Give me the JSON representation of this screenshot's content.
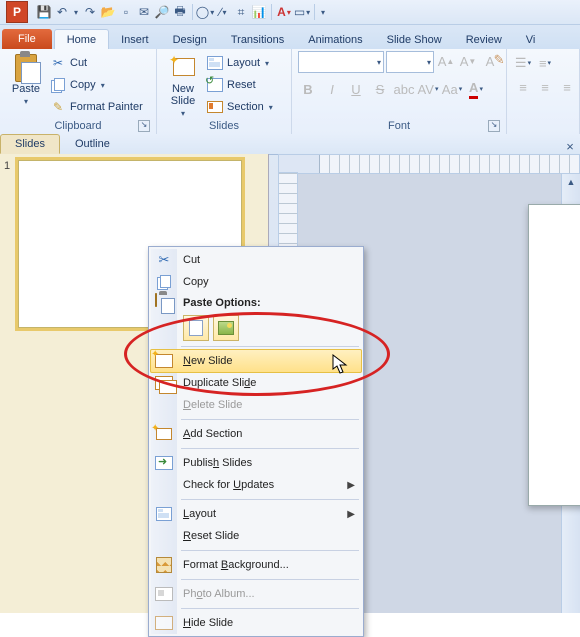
{
  "tabs": {
    "file": "File",
    "home": "Home",
    "insert": "Insert",
    "design": "Design",
    "transitions": "Transitions",
    "animations": "Animations",
    "slideshow": "Slide Show",
    "review": "Review",
    "view": "Vi"
  },
  "ribbon": {
    "clipboard": {
      "label": "Clipboard",
      "paste": "Paste",
      "cut": "Cut",
      "copy": "Copy",
      "painter": "Format Painter"
    },
    "slides": {
      "label": "Slides",
      "newslide": "New\nSlide",
      "layout": "Layout",
      "reset": "Reset",
      "section": "Section"
    },
    "font": {
      "label": "Font"
    }
  },
  "panes": {
    "slides": "Slides",
    "outline": "Outline",
    "slide_number": "1"
  },
  "ctx": {
    "cut": "Cut",
    "copy": "Copy",
    "paste_options": "Paste Options:",
    "new_slide_pre": "N",
    "new_slide_post": "ew Slide",
    "duplicate_pre": "Duplicate Sli",
    "duplicate_u": "d",
    "duplicate_post": "e",
    "delete_pre": "D",
    "delete_post": "elete Slide",
    "add_section_pre": "A",
    "add_section_post": "dd Section",
    "publish_pre": "Publis",
    "publish_u": "h",
    "publish_post": " Slides",
    "updates_pre": "Check for ",
    "updates_u": "U",
    "updates_post": "pdates",
    "layout_pre": "L",
    "layout_post": "ayout",
    "reset_pre": "R",
    "reset_post": "eset Slide",
    "format_bg_pre": "Format ",
    "format_bg_u": "B",
    "format_bg_post": "ackground...",
    "photo_album_pre": "Ph",
    "photo_album_u": "o",
    "photo_album_post": "to Album...",
    "hide_pre": "H",
    "hide_post": "ide Slide"
  }
}
